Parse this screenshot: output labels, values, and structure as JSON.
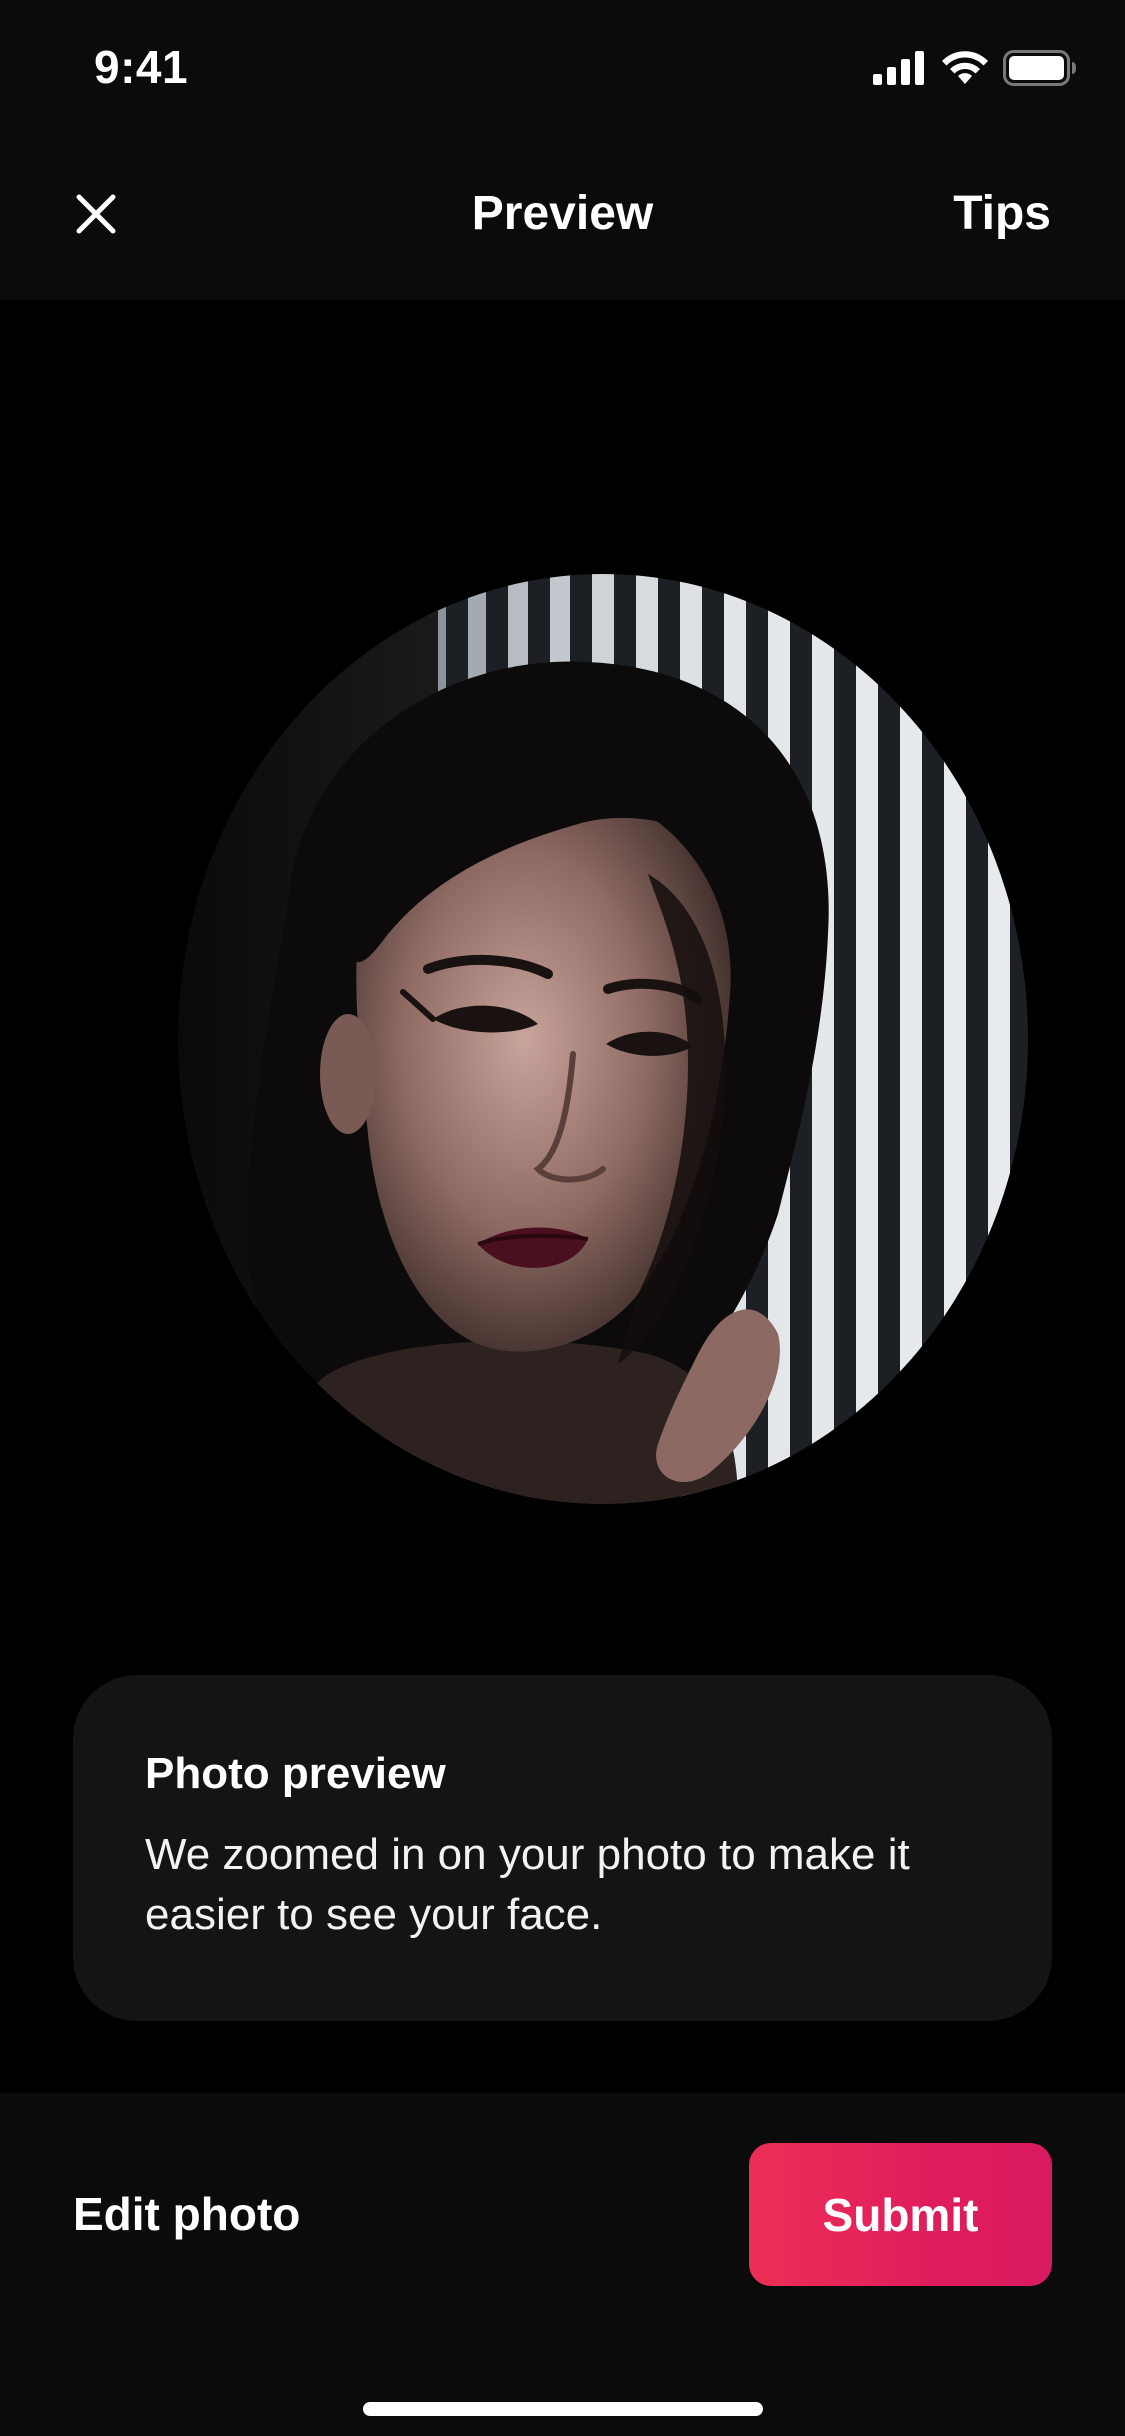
{
  "status_bar": {
    "time": "9:41",
    "icons": [
      "cellular-signal-icon",
      "wifi-icon",
      "battery-icon"
    ]
  },
  "header": {
    "close_icon": "close-icon",
    "title": "Preview",
    "tips_label": "Tips"
  },
  "photo": {
    "description_icon": "profile-photo"
  },
  "info_card": {
    "title": "Photo preview",
    "body": "We zoomed in on your photo to make it easier to see your face."
  },
  "bottom_bar": {
    "edit_label": "Edit photo",
    "submit_label": "Submit"
  },
  "colors": {
    "background": "#000000",
    "surface": "#0b0b0b",
    "card": "#141414",
    "accent": "#e31c5f",
    "text": "#ffffff"
  }
}
